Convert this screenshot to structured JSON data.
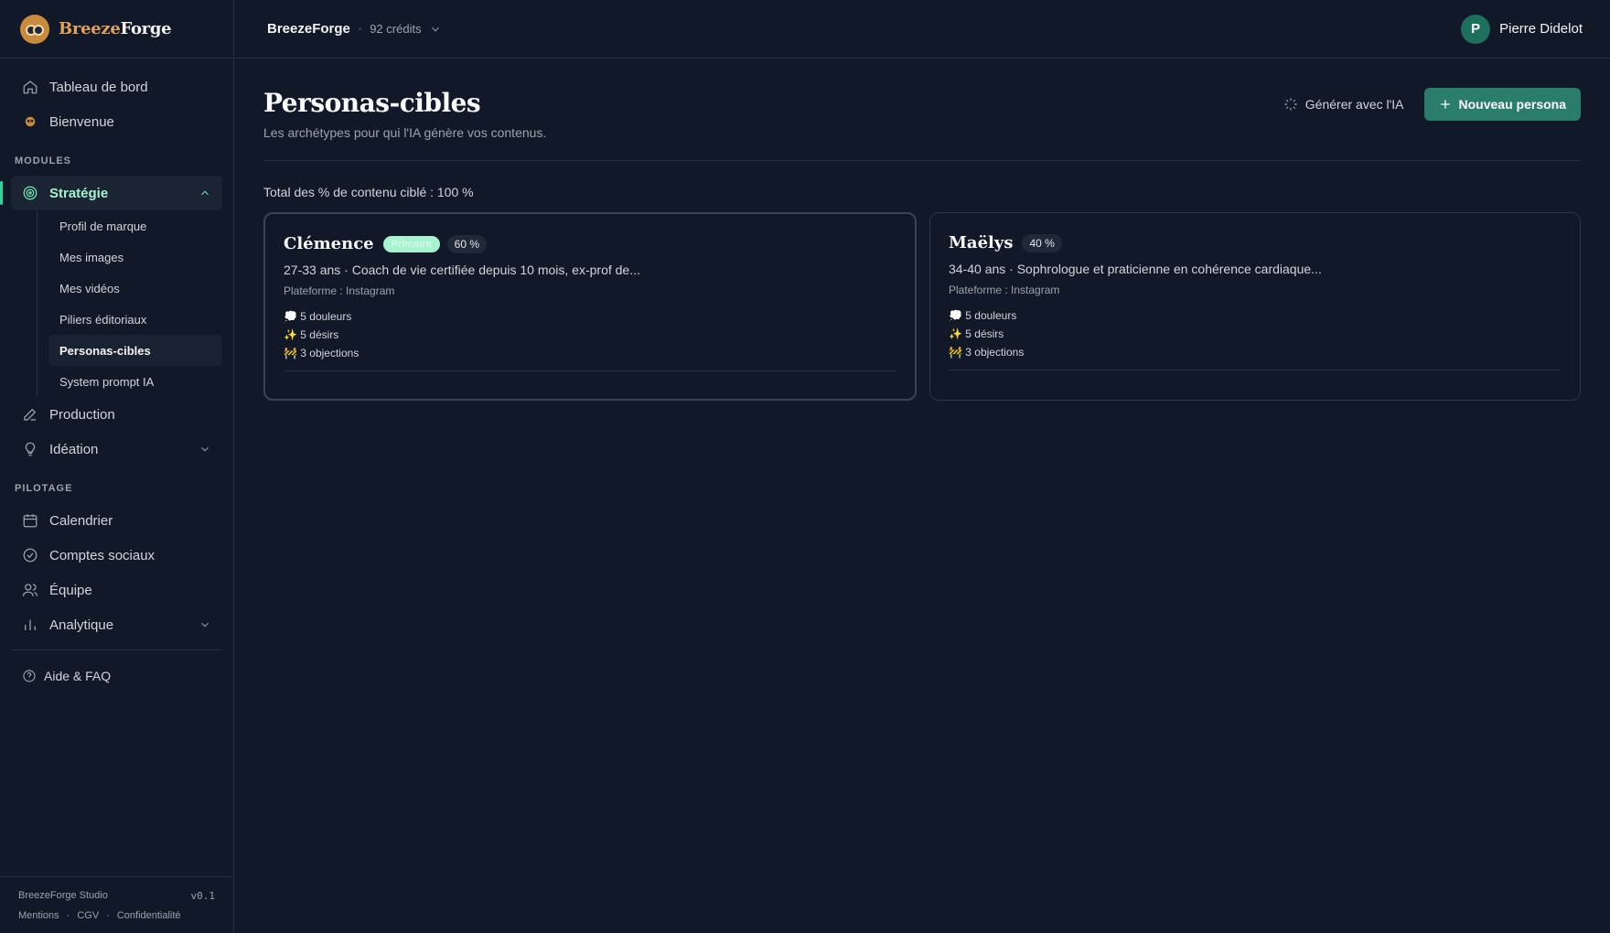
{
  "logo": {
    "part1": "Breeze",
    "part2": "Forge"
  },
  "sidebar": {
    "top_items": [
      {
        "label": "Tableau de bord",
        "icon": "home-icon"
      },
      {
        "label": "Bienvenue",
        "icon": "owl-icon"
      }
    ],
    "modules_title": "MODULES",
    "strategie": {
      "label": "Stratégie",
      "icon": "target-icon"
    },
    "strategie_sub": [
      {
        "label": "Profil de marque"
      },
      {
        "label": "Mes images"
      },
      {
        "label": "Mes vidéos"
      },
      {
        "label": "Piliers éditoriaux"
      },
      {
        "label": "Personas-cibles"
      },
      {
        "label": "System prompt IA"
      }
    ],
    "production": {
      "label": "Production",
      "icon": "pencil-icon"
    },
    "ideation": {
      "label": "Idéation",
      "icon": "lightbulb-icon"
    },
    "pilotage_title": "PILOTAGE",
    "pilotage_items": [
      {
        "label": "Calendrier",
        "icon": "calendar-icon"
      },
      {
        "label": "Comptes sociaux",
        "icon": "check-circle-icon"
      },
      {
        "label": "Équipe",
        "icon": "users-icon"
      }
    ],
    "analytique": {
      "label": "Analytique",
      "icon": "bar-chart-icon"
    },
    "help": {
      "label": "Aide & FAQ",
      "icon": "help-circle-icon"
    },
    "footer": {
      "studio": "BreezeForge Studio",
      "version": "v0.1",
      "links": [
        "Mentions",
        "CGV",
        "Confidentialité"
      ]
    }
  },
  "topbar": {
    "brand": "BreezeForge",
    "separator": "·",
    "credits": "92 crédits",
    "user_initial": "P",
    "user_name": "Pierre Didelot"
  },
  "page": {
    "title": "Personas-cibles",
    "subtitle": "Les archétypes pour qui l'IA génère vos contenus.",
    "generate_label": "Générer avec l'IA",
    "new_label": "Nouveau persona",
    "total": "Total des % de contenu ciblé : 100 %"
  },
  "personas": [
    {
      "name": "Clémence",
      "tag": "Primaire",
      "percent": "60 %",
      "description": "27-33 ans · Coach de vie certifiée depuis 10 mois, ex-prof de...",
      "platform": "Plateforme : Instagram",
      "pains": "💭 5 douleurs",
      "desires": "✨ 5 désirs",
      "objections": "🚧 3 objections"
    },
    {
      "name": "Maëlys",
      "percent": "40 %",
      "description": "34-40 ans · Sophrologue et praticienne en cohérence cardiaque...",
      "platform": "Plateforme : Instagram",
      "pains": "💭 5 douleurs",
      "desires": "✨ 5 désirs",
      "objections": "🚧 3 objections"
    }
  ]
}
